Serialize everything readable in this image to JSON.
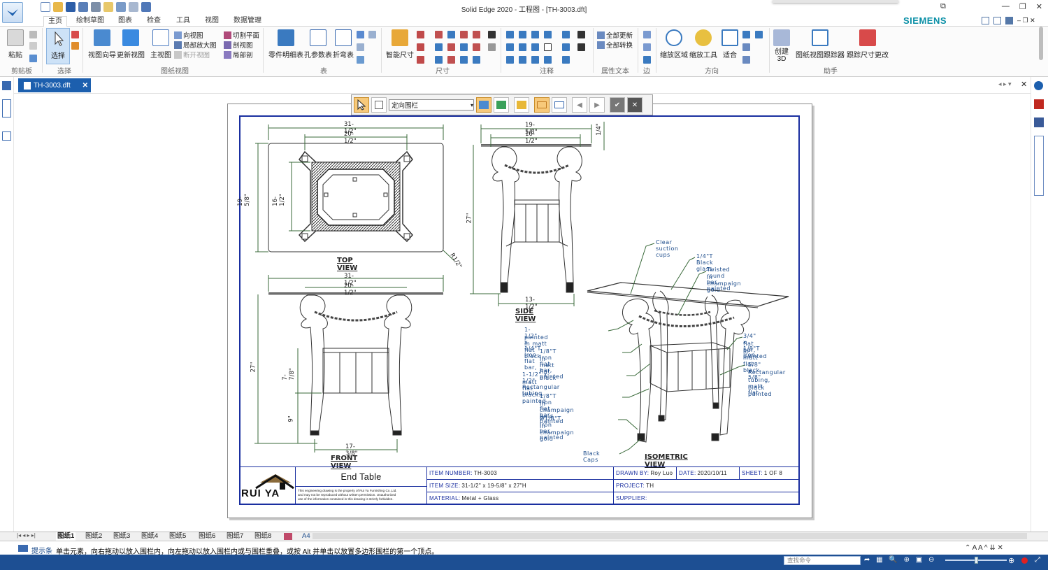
{
  "titlebar": {
    "title": "Solid Edge 2020 - 工程图 - [TH-3003.dft]",
    "brand": "SIEMENS"
  },
  "menu_tabs": [
    {
      "label": "主页",
      "active": true
    },
    {
      "label": "绘制草图"
    },
    {
      "label": "图表"
    },
    {
      "label": "检查"
    },
    {
      "label": "工具"
    },
    {
      "label": "视图"
    },
    {
      "label": "数据管理"
    }
  ],
  "ribbon": {
    "paste": "粘贴",
    "select": "选择",
    "view_wizard": "视图向导",
    "update_views": "更新视图",
    "principal_view": "主视图",
    "auxiliary": "向视图",
    "detail": "局部放大图",
    "broken": "断开视图",
    "cutting_plane": "切割平面",
    "section": "剖视图",
    "broken_out": "局部剖",
    "parts_list": "零件明细表",
    "hole_table": "孔参数表",
    "bend_table": "折弯表",
    "smart_dim": "智能尺寸",
    "update_all": "全部更新",
    "convert_all": "全部转换",
    "zoom_area": "缩放区域",
    "zoom_tool": "缩放工具",
    "fit": "适合",
    "create_3d": "创建 3D",
    "view_tracker": "图纸视图跟踪器",
    "track_dim": "跟踪尺寸更改",
    "groups": {
      "clipboard": "剪贴板",
      "select": "选择",
      "drawing_views": "图纸视图",
      "tables": "表",
      "dimension": "尺寸",
      "annotation": "注释",
      "property_text": "属性文本",
      "edges": "边",
      "orient": "方向",
      "assistant": "助手"
    }
  },
  "doc_tab": {
    "label": "TH-3003.dft"
  },
  "fence_toolbar": {
    "mode": "定向围栏"
  },
  "drawing": {
    "top_view_label": "TOP VIEW",
    "side_view_label": "SIDE VIEW",
    "front_view_label": "FRONT VIEW",
    "iso_view_label": "ISOMETRIC VIEW",
    "dims": {
      "top_w1": "31-1/2\"",
      "top_w2": "20-1/2\"",
      "top_h1": "19-5/8\"",
      "top_h2": "16-1/2\"",
      "top_r": "R1/2\"",
      "side_w1": "19-5/8\"",
      "side_w2": "16-1/2\"",
      "side_t": "1/4\"",
      "side_h": "27\"",
      "side_b": "13-1/2\"",
      "front_w1": "31-1/2\"",
      "front_w2": "20-1/2\"",
      "front_h": "27\"",
      "front_h2": "7-7/8\"",
      "front_h3": "9\"",
      "front_b": "17-3/8\""
    },
    "notes": {
      "n1": "Clear suction cups",
      "n2": "1/4\"T Black glass",
      "n3a": "Twisted round bar, painted",
      "n3b": "in champaign gold",
      "n4a": "1-1/2\" x 1/4\"T Iron flat bar,",
      "n4b": "painted in  matt flat black",
      "n5a": "1/8\"T Iron flat bar, painted",
      "n5b": "in  matt flat black",
      "n6a": "1-1/2\" x 1/2\" Rectangular tubing,",
      "n6b": "matt flat black painted",
      "n7a": "1/8\"T Iron flat bar, painted",
      "n7b": "in champaign gold",
      "n8a": "Ø1/8\"T Iron bar, painted",
      "n8b": "in champaign gold",
      "n9": "Black Caps",
      "n10a": "3/4\" x 1/8\"T Iron",
      "n10b": "flat bar, painted",
      "n10c": "in  matt flat black",
      "n11a": "5/8\" x 5/8\"",
      "n11b": "Rectangular",
      "n11c": "tubing, matt flat",
      "n11d": "black painted"
    }
  },
  "titleblock": {
    "company": "RUI YA",
    "title": "End Table",
    "disclaimer1": "This engineering drawing is the property of Rui Ya Furnishing Co.,Ltd.",
    "disclaimer2": "and may not be reproduced without written permission. Unauthorized",
    "disclaimer3": "use of the information contained in this drawing is strictly forbidden.",
    "item_number_k": "ITEM NUMBER:",
    "item_number_v": "TH-3003",
    "item_size_k": "ITEM SIZE:",
    "item_size_v": "31-1/2\" x 19-5/8\" x 27\"H",
    "material_k": "MATERIAL:",
    "material_v": "Metal + Glass",
    "drawn_by_k": "DRAWN BY:",
    "drawn_by_v": "Roy Luo",
    "date_k": "DATE:",
    "date_v": "2020/10/11",
    "sheet_k": "SHEET:",
    "sheet_v": "1 OF 8",
    "project_k": "PROJECT:",
    "project_v": "TH",
    "supplier_k": "SUPPLIER:"
  },
  "sheet_tabs": [
    "图纸1",
    "图纸2",
    "图纸3",
    "图纸4",
    "图纸5",
    "图纸6",
    "图纸7",
    "图纸8",
    "A4"
  ],
  "prompt": {
    "label": "提示条",
    "text": "单击元素，向右拖动以放入围栏内，向左拖动以放入围栏内或与围栏重叠，或按 Alt 并单击以放置多边形围栏的第一个顶点。"
  },
  "status": {
    "search_placeholder": "查找命令"
  },
  "colors": {
    "accent": "#1c5fae",
    "frame": "#1a2fa0",
    "brand": "#0a8fa6",
    "status_bar": "#1d4f93"
  }
}
